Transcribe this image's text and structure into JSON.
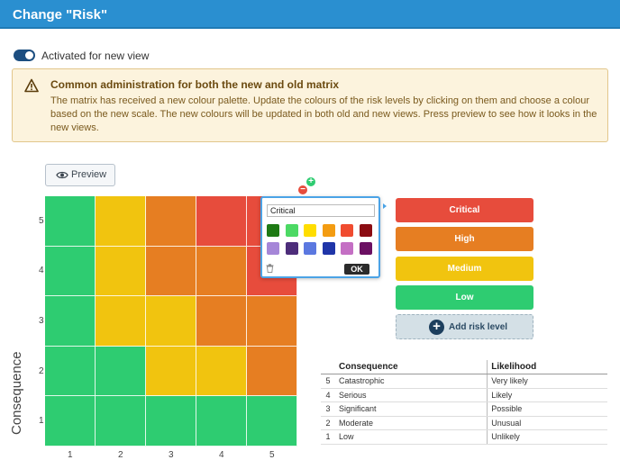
{
  "window": {
    "title": "Change \"Risk\""
  },
  "toggle": {
    "label": "Activated for new view",
    "on": true
  },
  "alert": {
    "heading": "Common administration for both the new and old matrix",
    "body": "The matrix has received a new colour palette. Update the colours of the risk levels by clicking on them and choose a colour based on the new scale. The new colours will be updated in both old and new views. Press preview to see how it looks in the new views."
  },
  "preview_button": {
    "label": "Preview",
    "icon": "eye-icon"
  },
  "matrix": {
    "y_axis_label": "Consequence",
    "y_ticks": [
      "5",
      "4",
      "3",
      "2",
      "1"
    ],
    "x_ticks": [
      "1",
      "2",
      "3",
      "4",
      "5"
    ],
    "grid": [
      [
        "green",
        "yellow",
        "orange",
        "red",
        "red"
      ],
      [
        "green",
        "yellow",
        "orange",
        "orange",
        "red"
      ],
      [
        "green",
        "yellow",
        "yellow",
        "orange",
        "orange"
      ],
      [
        "green",
        "green",
        "yellow",
        "yellow",
        "orange"
      ],
      [
        "green",
        "green",
        "green",
        "green",
        "green"
      ]
    ],
    "colors": {
      "green": "#2ecc71",
      "yellow": "#f1c40f",
      "orange": "#e67e22",
      "red": "#e74c3c"
    }
  },
  "color_popup": {
    "name_value": "Critical",
    "swatches": [
      "#1e7a14",
      "#4cd964",
      "#ffdd00",
      "#f39c12",
      "#f04c30",
      "#8b0c12",
      "#a586d8",
      "#4d2d7a",
      "#5b78e0",
      "#1f35a8",
      "#c46fc4",
      "#6b1062"
    ],
    "ok_label": "OK",
    "add_icon": "plus-circle-icon",
    "remove_icon": "minus-circle-icon",
    "delete_icon": "trash-icon"
  },
  "risk_levels": [
    {
      "label": "Critical",
      "color": "#e74c3c"
    },
    {
      "label": "High",
      "color": "#e67e22"
    },
    {
      "label": "Medium",
      "color": "#f1c40f"
    },
    {
      "label": "Low",
      "color": "#2ecc71"
    }
  ],
  "add_risk_level": {
    "label": "Add risk level"
  },
  "scale_table": {
    "headers": [
      "",
      "Consequence",
      "Likelihood"
    ],
    "rows": [
      [
        "5",
        "Catastrophic",
        "Very likely"
      ],
      [
        "4",
        "Serious",
        "Likely"
      ],
      [
        "3",
        "Significant",
        "Possible"
      ],
      [
        "2",
        "Moderate",
        "Unusual"
      ],
      [
        "1",
        "Low",
        "Unlikely"
      ]
    ]
  }
}
